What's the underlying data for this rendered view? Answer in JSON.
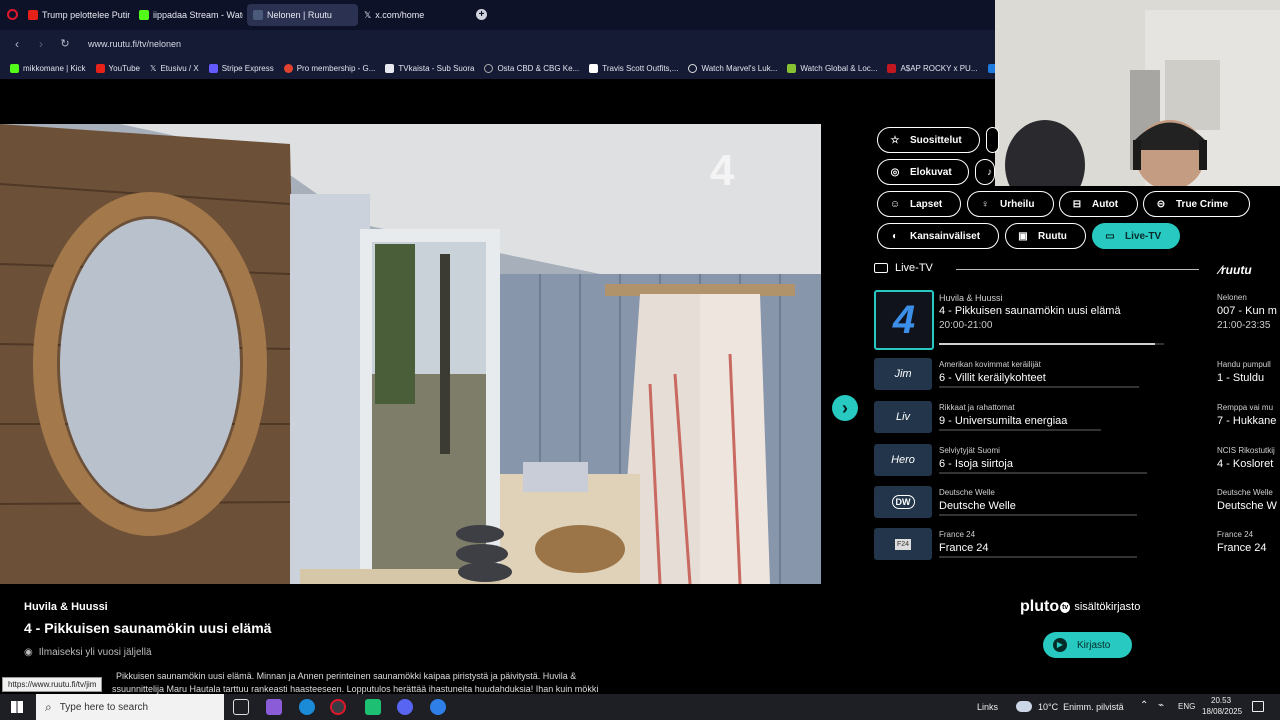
{
  "tabs": [
    {
      "label": "Trump pelottelee Putinia"
    },
    {
      "label": "iippadaa Stream - Watch"
    },
    {
      "label": "Nelonen | Ruutu"
    },
    {
      "label": "x.com/home"
    }
  ],
  "url": "www.ruutu.fi/tv/nelonen",
  "bookmarks": [
    "mikkomane | Kick",
    "YouTube",
    "Etusivu / X",
    "Stripe Express",
    "Pro membership - G...",
    "TVkaista - Sub Suora",
    "Osta CBD & CBG Ke...",
    "Travis Scott Outfits,...",
    "Watch Marvel's Luk...",
    "Watch Global & Loc...",
    "A$AP ROCKY x PU...",
    "de"
  ],
  "video": {
    "channel_mark": "4"
  },
  "chips": [
    {
      "label": "Suosittelut",
      "icon": "☆"
    },
    {
      "label": "Elokuvat",
      "icon": "◎"
    },
    {
      "label": "Lapset",
      "icon": "☺"
    },
    {
      "label": "Urheilu",
      "icon": "♀"
    },
    {
      "label": "Autot",
      "icon": "⊟"
    },
    {
      "label": "True Crime",
      "icon": "⊝"
    },
    {
      "label": "Kansainväliset",
      "icon": "◐"
    },
    {
      "label": "Ruutu",
      "icon": "▣"
    },
    {
      "label": "Live-TV",
      "icon": "▭"
    }
  ],
  "guide": {
    "header": "Live-TV",
    "brand": "ruutu",
    "rows": [
      {
        "logo": "4",
        "small": "Huvila & Huussi",
        "title": "4 - Pikkuisen saunamökin uusi elämä",
        "time": "20:00-21:00",
        "progress": 0.96,
        "col2_small": "Nelonen",
        "col2_title": "007 - Kun m",
        "col2_time": "21:00-23:35"
      },
      {
        "logo": "Jim",
        "small": "Amerikan kovimmat keräilijät",
        "title": "6 - Villit keräilykohteet",
        "progress": 0,
        "col2_small": "Handu pumpull",
        "col2_title": "1 - Stuldu"
      },
      {
        "logo": "Liv",
        "small": "Rikkaat ja rahattomat",
        "title": "9 - Universumilta energiaa",
        "progress": 0,
        "col2_small": "Remppa vai mu",
        "col2_title": "7 - Hukkane"
      },
      {
        "logo": "Hero",
        "small": "Selviytyjät Suomi",
        "title": "6 - Isoja siirtoja",
        "progress": 0,
        "col2_small": "NCIS Rikostutkij",
        "col2_title": "4 - Kosloret"
      },
      {
        "logo": "DW",
        "small": "Deutsche Welle",
        "title": "Deutsche Welle",
        "progress": 0,
        "col2_small": "Deutsche Welle",
        "col2_title": "Deutsche W"
      },
      {
        "logo": "F24",
        "small": "France 24",
        "title": "France 24",
        "progress": 0,
        "col2_small": "France 24",
        "col2_title": "France 24"
      }
    ]
  },
  "program": {
    "series": "Huvila & Huussi",
    "episode": "4 - Pikkuisen saunamökin uusi elämä",
    "availability": "Ilmaiseksi yli vuosi jäljellä",
    "desc_line1": "Pikkuisen saunamökin uusi elämä. Minnan ja Annen perinteinen saunamökki kaipaa piristystä ja päivitystä. Huvila &",
    "desc_line2": "ssuunnittelija Maru Hautala tarttuu rankeasti haasteeseen. Lopputulos herättää ihastuneita huudahduksia! Ihan kuin mökki"
  },
  "status_url": "https://www.ruutu.fi/tv/jim",
  "pluto": {
    "logo": "pluto",
    "tv": "tv",
    "text": "sisältökirjasto",
    "button": "Kirjasto"
  },
  "taskbar": {
    "search_placeholder": "Type here to search",
    "links": "Links",
    "weather": "10°C  Enimm. pilvistä",
    "lang": "ENG",
    "time": "20.53",
    "date": "18/08/2025"
  }
}
